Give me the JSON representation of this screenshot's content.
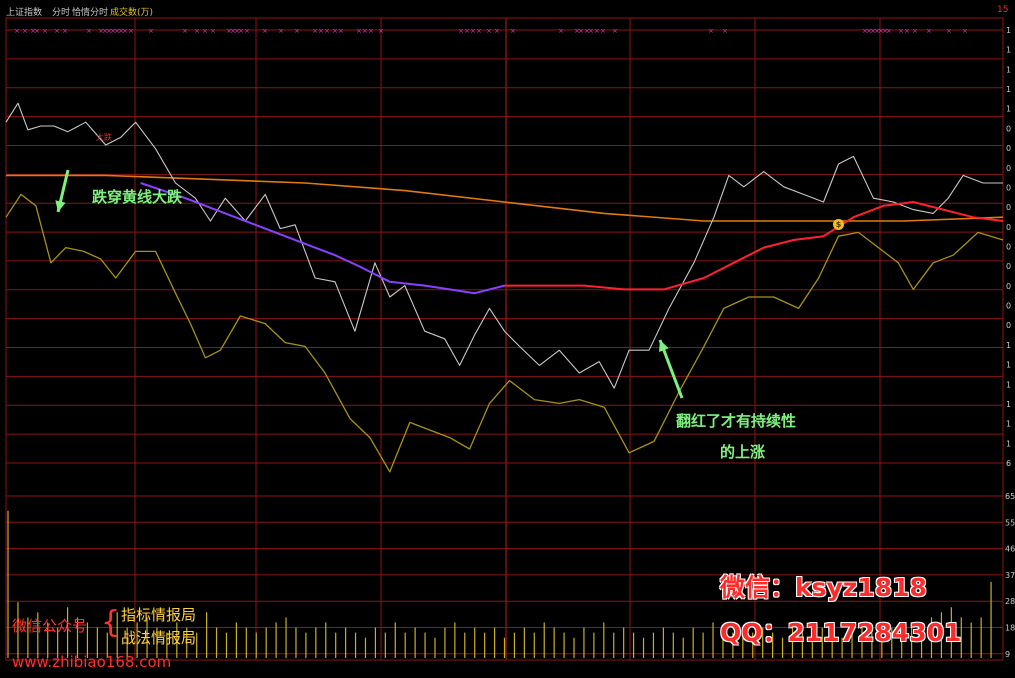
{
  "header": {
    "index_name": "上证指数",
    "tab_intraday": "分时",
    "tab_multi": "恰情分时",
    "volume_label": "成交数(万)",
    "corner_mark": "15"
  },
  "annotations": {
    "top_left_text": "跌穿黄线大跌",
    "bottom_right_line1": "翻红了才有持续性",
    "bottom_right_line2": "的上涨",
    "small_red": "大跌",
    "coin_marker": "$"
  },
  "watermark": {
    "wechat_public": "微信公众号",
    "brace": "{",
    "name1": "指标情报局",
    "name2": "战法情报局",
    "site": "www.zhibiao168.com",
    "wechat": "微信：ksyz1818",
    "qq": "QQ：2117284301"
  },
  "colors": {
    "background": "#000000",
    "grid": "#8b1414",
    "white_line": "#c8c8c8",
    "yellow_line": "#a89214",
    "orange_line": "#e07a10",
    "purple_line": "#8a40ff",
    "red_line": "#ff2030",
    "volume": "#c8b020",
    "markers": "#d040d0"
  },
  "chart_data": {
    "type": "line",
    "title": "上证指数",
    "price_axis_right_ticks": [
      "1",
      "1",
      "1",
      "1",
      "1",
      "0",
      "0",
      "0",
      "0",
      "0",
      "0",
      "0",
      "0",
      "0",
      "0",
      "0",
      "1",
      "1",
      "1",
      "1",
      "1",
      "1",
      "6"
    ],
    "volume_axis_right_ticks": [
      "65",
      "55",
      "46",
      "37",
      "28",
      "18",
      "9"
    ],
    "legend": [
      "分时",
      "恰情分时",
      "成交数(万)"
    ],
    "grid": true,
    "series": [
      {
        "name": "white",
        "x": [
          0,
          12,
          22,
          35,
          48,
          62,
          80,
          100,
          115,
          130,
          150,
          170,
          190,
          205,
          220,
          240,
          260,
          275,
          290,
          310,
          330,
          350,
          370,
          385,
          400,
          420,
          440,
          455,
          470,
          485,
          500,
          515,
          535,
          555,
          575,
          595,
          610,
          625,
          645,
          665,
          690,
          710,
          725,
          740,
          760,
          780,
          800,
          820,
          835,
          850,
          870,
          890,
          910,
          930,
          945,
          960,
          980,
          1000
        ],
        "y": [
          62,
          72,
          58,
          60,
          60,
          57,
          62,
          50,
          54,
          62,
          48,
          30,
          22,
          10,
          22,
          10,
          24,
          6,
          8,
          -20,
          -22,
          -48,
          -12,
          -30,
          -24,
          -48,
          -52,
          -66,
          -50,
          -36,
          -48,
          -56,
          -66,
          -58,
          -70,
          -64,
          -78,
          -58,
          -58,
          -36,
          -12,
          12,
          34,
          28,
          36,
          28,
          24,
          20,
          40,
          44,
          22,
          20,
          16,
          14,
          22,
          34,
          30,
          30
        ]
      },
      {
        "name": "yellow",
        "x": [
          0,
          15,
          30,
          45,
          60,
          78,
          95,
          110,
          130,
          150,
          170,
          185,
          200,
          215,
          235,
          260,
          280,
          300,
          320,
          345,
          365,
          385,
          405,
          425,
          445,
          465,
          485,
          505,
          530,
          555,
          575,
          600,
          625,
          650,
          675,
          700,
          720,
          745,
          770,
          795,
          815,
          835,
          855,
          875,
          895,
          910,
          930,
          950,
          975,
          1000
        ],
        "y": [
          12,
          24,
          18,
          -12,
          -4,
          -6,
          -10,
          -20,
          -6,
          -6,
          -28,
          -44,
          -62,
          -58,
          -40,
          -44,
          -54,
          -56,
          -70,
          -94,
          -104,
          -122,
          -96,
          -100,
          -104,
          -110,
          -86,
          -74,
          -84,
          -86,
          -84,
          -88,
          -112,
          -106,
          -80,
          -56,
          -36,
          -30,
          -30,
          -36,
          -20,
          2,
          4,
          -4,
          -12,
          -26,
          -12,
          -8,
          4,
          0
        ]
      },
      {
        "name": "orange_avg",
        "x": [
          0,
          100,
          200,
          300,
          400,
          500,
          600,
          700,
          800,
          900,
          1000
        ],
        "y": [
          34,
          34,
          32,
          30,
          26,
          20,
          14,
          10,
          10,
          10,
          12
        ]
      },
      {
        "name": "purple_avg",
        "x": [
          135,
          180,
          220,
          260,
          300,
          330,
          355,
          385,
          420,
          445,
          470,
          500
        ],
        "y": [
          30,
          22,
          14,
          6,
          -2,
          -8,
          -14,
          -22,
          -24,
          -26,
          -28,
          -24
        ]
      },
      {
        "name": "red_avg",
        "x": [
          500,
          540,
          580,
          620,
          660,
          700,
          730,
          760,
          790,
          820,
          850,
          880,
          910,
          940,
          970,
          1000
        ],
        "y": [
          -24,
          -24,
          -24,
          -26,
          -26,
          -20,
          -12,
          -4,
          0,
          2,
          12,
          18,
          20,
          16,
          12,
          10
        ]
      }
    ],
    "volume": [
      58,
      22,
      16,
      18,
      14,
      12,
      20,
      16,
      14,
      12,
      10,
      18,
      12,
      14,
      16,
      12,
      10,
      14,
      12,
      10,
      18,
      12,
      10,
      14,
      12,
      10,
      12,
      14,
      16,
      12,
      10,
      12,
      14,
      10,
      12,
      10,
      8,
      12,
      10,
      14,
      10,
      12,
      10,
      8,
      12,
      14,
      10,
      12,
      10,
      12,
      8,
      10,
      12,
      10,
      14,
      12,
      10,
      8,
      12,
      10,
      14,
      10,
      12,
      10,
      8,
      10,
      12,
      10,
      8,
      12,
      10,
      14,
      12,
      10,
      8,
      10,
      12,
      10,
      8,
      12,
      10,
      14,
      12,
      10,
      8,
      10,
      12,
      10,
      8,
      12,
      10,
      14,
      12,
      16,
      18,
      20,
      16,
      14,
      16,
      30
    ]
  }
}
